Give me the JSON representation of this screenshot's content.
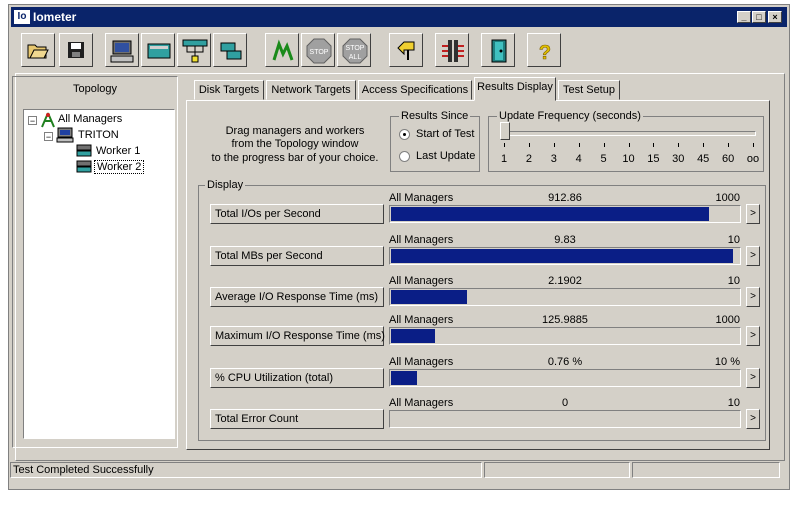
{
  "window": {
    "title": "Iometer",
    "app_icon": "Io",
    "minimize": "_",
    "maximize": "□",
    "close": "×"
  },
  "toolbar": {
    "buttons": [
      {
        "name": "open-icon"
      },
      {
        "name": "save-icon"
      },
      {
        "name": "new-disk-worker-icon"
      },
      {
        "name": "new-network-worker-icon"
      },
      {
        "name": "new-manager-icon"
      },
      {
        "name": "copy-worker-icon"
      },
      {
        "name": "start-tests-icon"
      },
      {
        "name": "stop-icon",
        "label": "STOP"
      },
      {
        "name": "stop-all-icon",
        "label": "STOP",
        "label2": "ALL"
      },
      {
        "name": "reset-workers-icon"
      },
      {
        "name": "disconnect-icon"
      },
      {
        "name": "exit-icon"
      },
      {
        "name": "about-icon",
        "label": "?"
      }
    ]
  },
  "topology": {
    "title": "Topology",
    "tree": [
      {
        "label": "All Managers",
        "expander": "−"
      },
      {
        "label": "TRITON",
        "expander": "−"
      },
      {
        "label": "Worker 1"
      },
      {
        "label": "Worker 2"
      }
    ]
  },
  "tabs": [
    "Disk Targets",
    "Network Targets",
    "Access Specifications",
    "Results Display",
    "Test Setup"
  ],
  "results": {
    "instructions": [
      "Drag managers and workers",
      "from the Topology window",
      "to the progress bar of your choice."
    ],
    "results_since": {
      "label": "Results Since",
      "options": [
        "Start of Test",
        "Last Update"
      ],
      "selected": "Start of Test"
    },
    "update_frequency": {
      "label": "Update Frequency (seconds)",
      "ticks": [
        "1",
        "2",
        "3",
        "4",
        "5",
        "10",
        "15",
        "30",
        "45",
        "60",
        "oo"
      ]
    },
    "display": {
      "label": "Display",
      "rows": [
        {
          "button": "Total I/Os per Second",
          "source": "All Managers",
          "value": "912.86",
          "max": "1000",
          "fraction": 0.9129
        },
        {
          "button": "Total MBs per Second",
          "source": "All Managers",
          "value": "9.83",
          "max": "10",
          "fraction": 0.983
        },
        {
          "button": "Average I/O Response Time (ms)",
          "source": "All Managers",
          "value": "2.1902",
          "max": "10",
          "fraction": 0.219
        },
        {
          "button": "Maximum I/O Response Time (ms)",
          "source": "All Managers",
          "value": "125.9885",
          "max": "1000",
          "fraction": 0.126
        },
        {
          "button": "% CPU Utilization (total)",
          "source": "All Managers",
          "value": "0.76 %",
          "max": "10 %",
          "fraction": 0.076
        },
        {
          "button": "Total Error Count",
          "source": "All Managers",
          "value": "0",
          "max": "10",
          "fraction": 0
        }
      ],
      "arrow": ">"
    }
  },
  "status_bar": {
    "text": "Test Completed Successfully"
  },
  "colors": {
    "title_bar": "#0a246a",
    "bar_fill": "#0a1e86",
    "face": "#d4d0c8"
  }
}
